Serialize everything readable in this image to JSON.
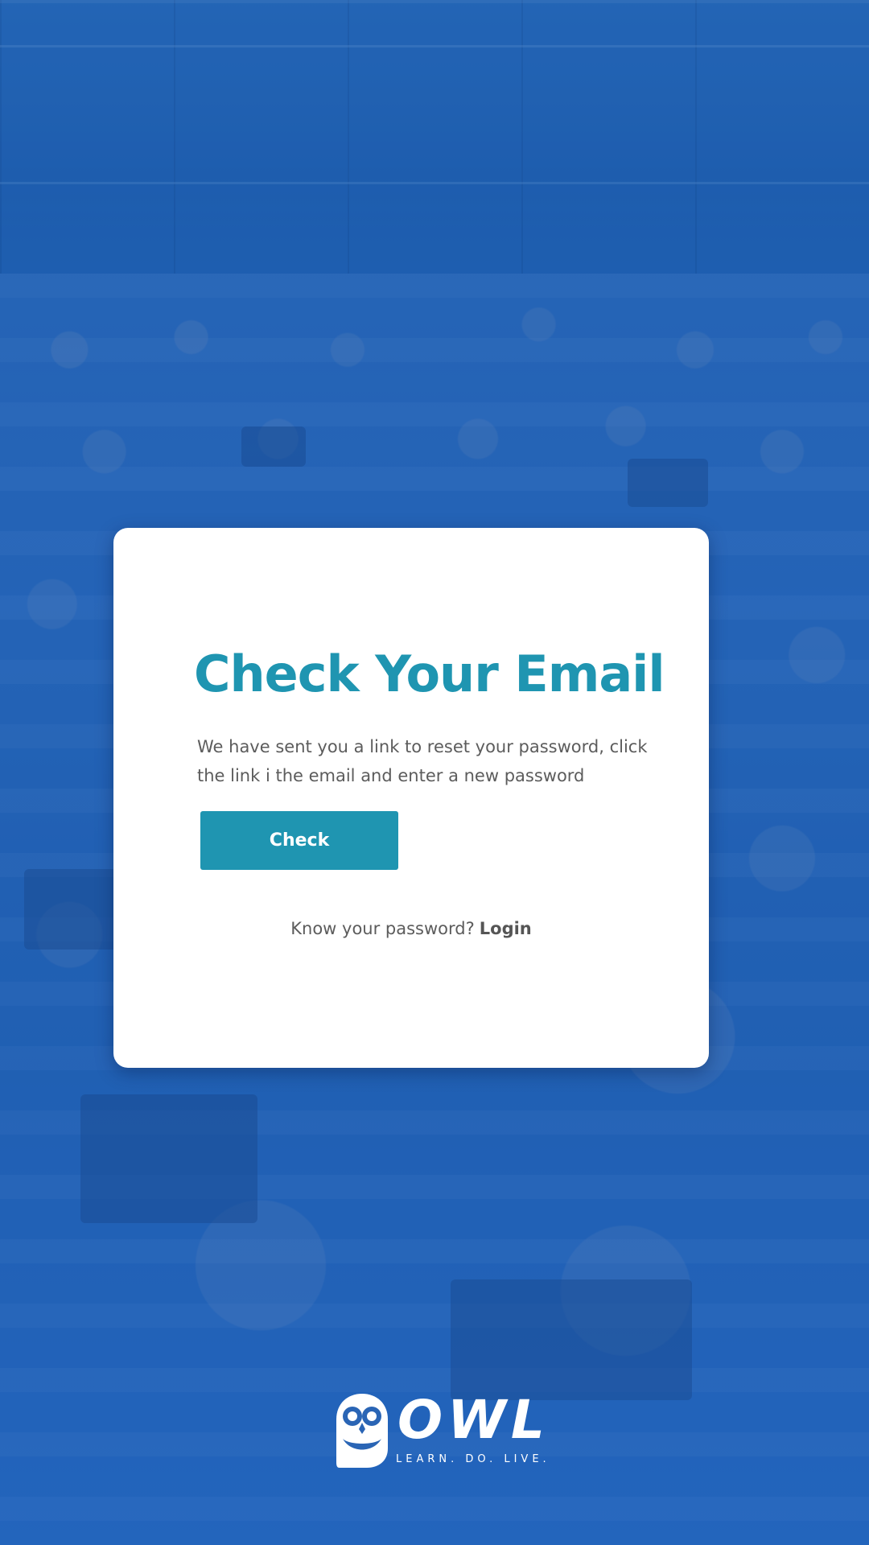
{
  "card": {
    "title": "Check Your Email",
    "message": "We have sent you a link to reset your password, click the link i the email and enter a new password",
    "button_label": "Check",
    "login_prompt": "Know your password?",
    "login_link": "Login"
  },
  "logo": {
    "wordmark": "OWL",
    "tagline": "LEARN. DO. LIVE."
  },
  "colors": {
    "accent": "#1f95b1",
    "background_tint": "#2a65b5",
    "card": "#ffffff",
    "text": "#5c5c5c"
  },
  "icons": {
    "logo": "owl-logo-icon"
  }
}
